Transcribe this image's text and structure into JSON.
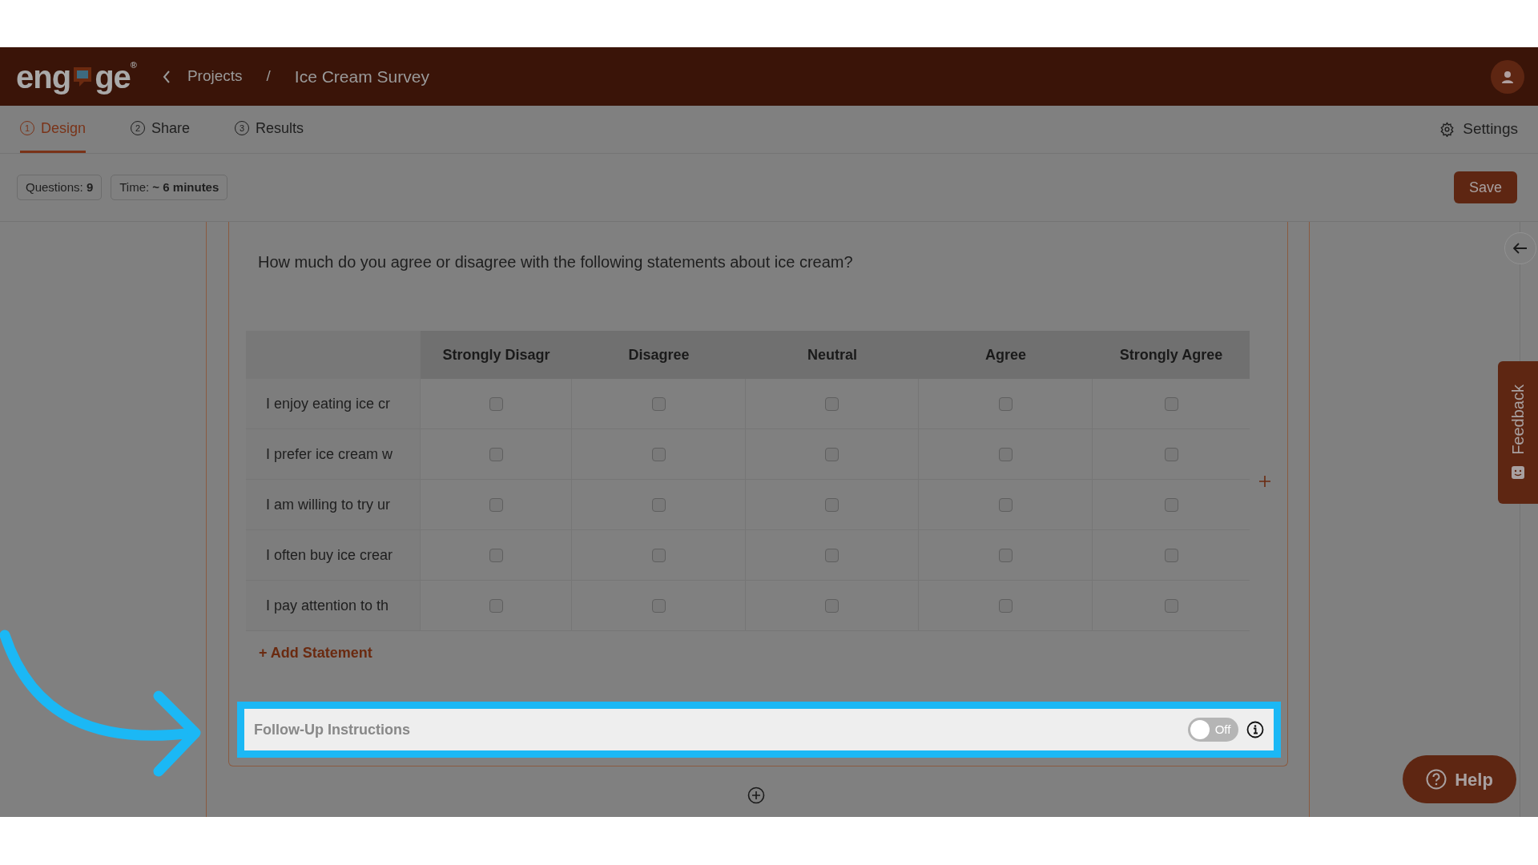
{
  "header": {
    "logo_left": "eng",
    "logo_right": "ge",
    "logo_mark": "®",
    "breadcrumb": [
      {
        "label": "Projects"
      },
      {
        "label": "Ice Cream Survey"
      }
    ],
    "separator": "/"
  },
  "tabs": [
    {
      "number": "1",
      "label": "Design",
      "selected": true
    },
    {
      "number": "2",
      "label": "Share",
      "selected": false
    },
    {
      "number": "3",
      "label": "Results",
      "selected": false
    }
  ],
  "settings": "Settings",
  "toolbar": {
    "stats": [
      {
        "label": "Questions:",
        "value": "9"
      },
      {
        "label": "Time:",
        "value": "~ 6 minutes"
      }
    ],
    "save": "Save"
  },
  "question": {
    "text": "How much do you agree or disagree with the following statements about ice cream?",
    "columns": [
      "Strongly Disagr",
      "Disagree",
      "Neutral",
      "Agree",
      "Strongly Agree"
    ],
    "rows": [
      {
        "label": "I enjoy eating ice cr",
        "checked": [
          false,
          false,
          false,
          false,
          false
        ]
      },
      {
        "label": "I prefer ice cream w",
        "checked": [
          false,
          false,
          false,
          false,
          false
        ]
      },
      {
        "label": "I am willing to try ur",
        "checked": [
          false,
          false,
          false,
          false,
          false
        ]
      },
      {
        "label": "I often buy ice crear",
        "checked": [
          false,
          false,
          false,
          false,
          false
        ]
      },
      {
        "label": "I pay attention to th",
        "checked": [
          false,
          false,
          false,
          false,
          false
        ]
      }
    ],
    "add_statement": "+ Add Statement",
    "follow_up": {
      "label": "Follow-Up Instructions",
      "on": false,
      "toggle_text": "Off"
    }
  },
  "feedback": "Feedback",
  "help": "Help"
}
